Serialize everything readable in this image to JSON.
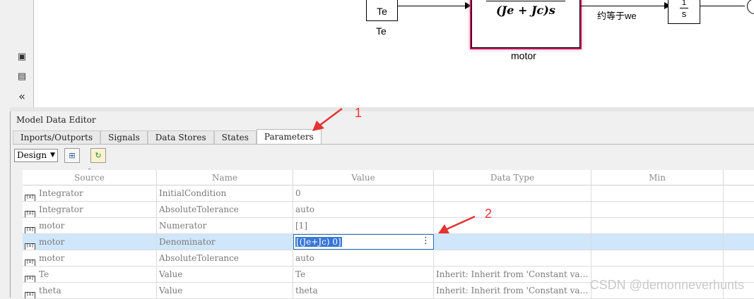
{
  "canvas": {
    "blocks": {
      "te_block_text": "Te",
      "te_label": "Te",
      "motor_denominator": "(Je + Jc)s",
      "motor_label": "motor",
      "integrator_numerator": "1",
      "integrator_denominator": "s",
      "wire_label": "约等于we"
    }
  },
  "editor": {
    "title": "Model Data Editor",
    "tabs": [
      "Inports/Outports",
      "Signals",
      "Data Stores",
      "States",
      "Parameters"
    ],
    "active_tab": "Parameters",
    "toolbar": {
      "view_select": "Design"
    },
    "columns": [
      "Source",
      "Name",
      "Value",
      "Data Type",
      "Min"
    ],
    "rows": [
      {
        "source": "Integrator",
        "name": "InitialCondition",
        "value": "0",
        "data_type": "",
        "min": ""
      },
      {
        "source": "Integrator",
        "name": "AbsoluteTolerance",
        "value": "auto",
        "data_type": "",
        "min": ""
      },
      {
        "source": "motor",
        "name": "Numerator",
        "value": "[1]",
        "data_type": "",
        "min": ""
      },
      {
        "source": "motor",
        "name": "Denominator",
        "value": "[(Je+Jc) 0]",
        "data_type": "",
        "min": ""
      },
      {
        "source": "motor",
        "name": "AbsoluteTolerance",
        "value": "auto",
        "data_type": "",
        "min": ""
      },
      {
        "source": "Te",
        "name": "Value",
        "value": "Te",
        "data_type": "Inherit: Inherit from 'Constant va…",
        "min": ""
      },
      {
        "source": "theta",
        "name": "Value",
        "value": "theta",
        "data_type": "Inherit: Inherit from 'Constant va…",
        "min": ""
      }
    ],
    "selected_row": 3
  },
  "annotations": {
    "marker_1": "1",
    "marker_2": "2"
  },
  "watermark": "CSDN @demonneverhunts",
  "colors": {
    "selection": "#cfe6fb",
    "arrow": "#e33333",
    "motor_highlight": "#c2185b"
  }
}
